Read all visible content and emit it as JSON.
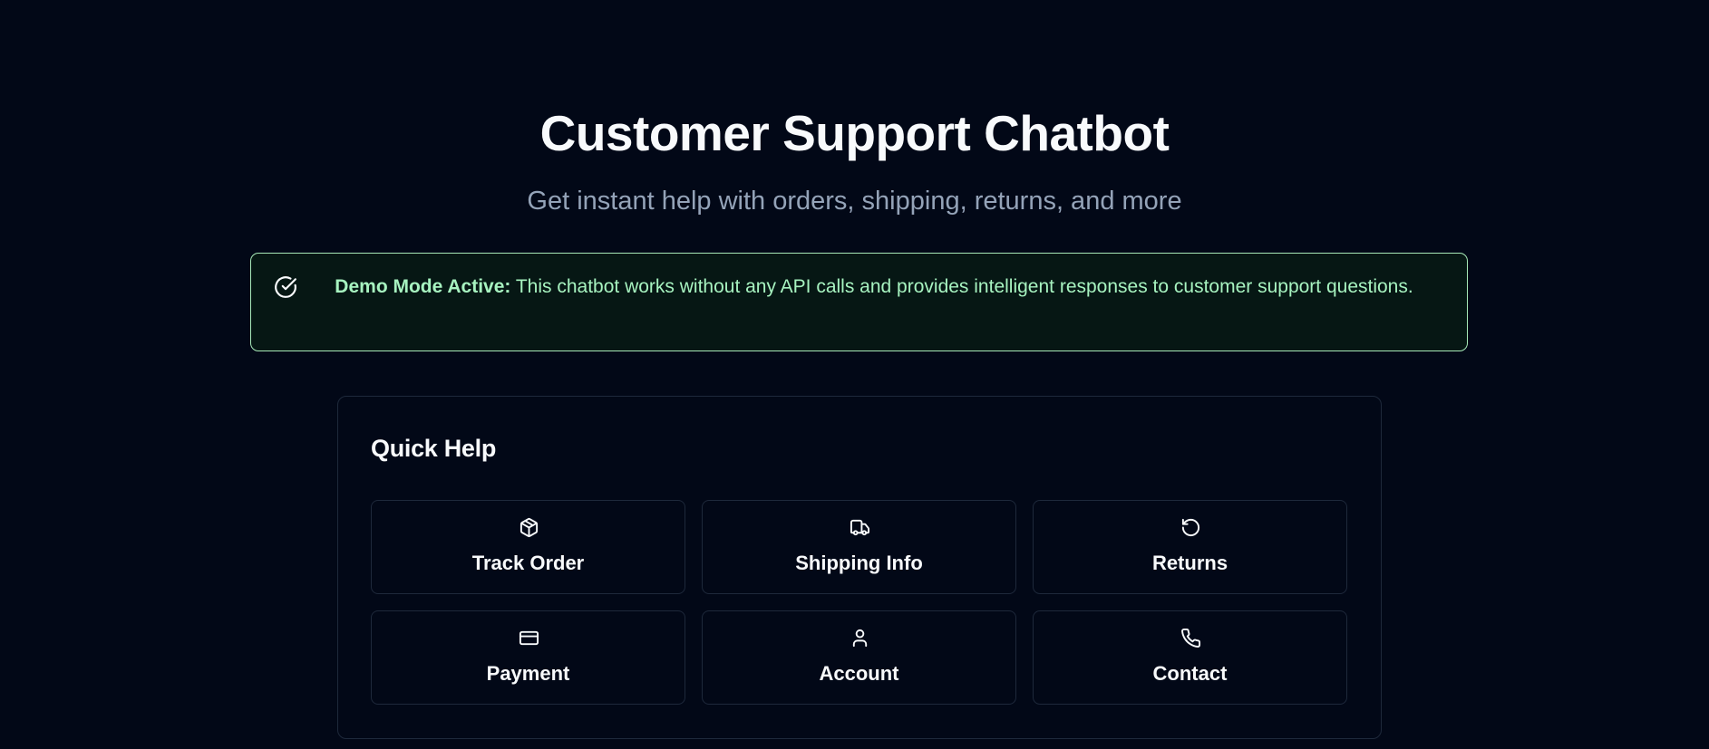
{
  "header": {
    "title": "Customer Support Chatbot",
    "subtitle": "Get instant help with orders, shipping, returns, and more"
  },
  "notice": {
    "icon": "check-circle-icon",
    "strong": "Demo Mode Active:",
    "text": " This chatbot works without any API calls and provides intelligent responses to customer support questions.",
    "color": "#a7f3c0",
    "border_color": "#a7e9b8"
  },
  "quick_help": {
    "title": "Quick Help",
    "buttons": [
      {
        "label": "Track Order",
        "icon": "package-icon"
      },
      {
        "label": "Shipping Info",
        "icon": "truck-icon"
      },
      {
        "label": "Returns",
        "icon": "rotate-ccw-icon"
      },
      {
        "label": "Payment",
        "icon": "credit-card-icon"
      },
      {
        "label": "Account",
        "icon": "user-icon"
      },
      {
        "label": "Contact",
        "icon": "phone-icon"
      }
    ]
  },
  "colors": {
    "background": "#020817",
    "text": "#f8fafc",
    "muted": "#94a3b8",
    "border": "#1e293b"
  }
}
